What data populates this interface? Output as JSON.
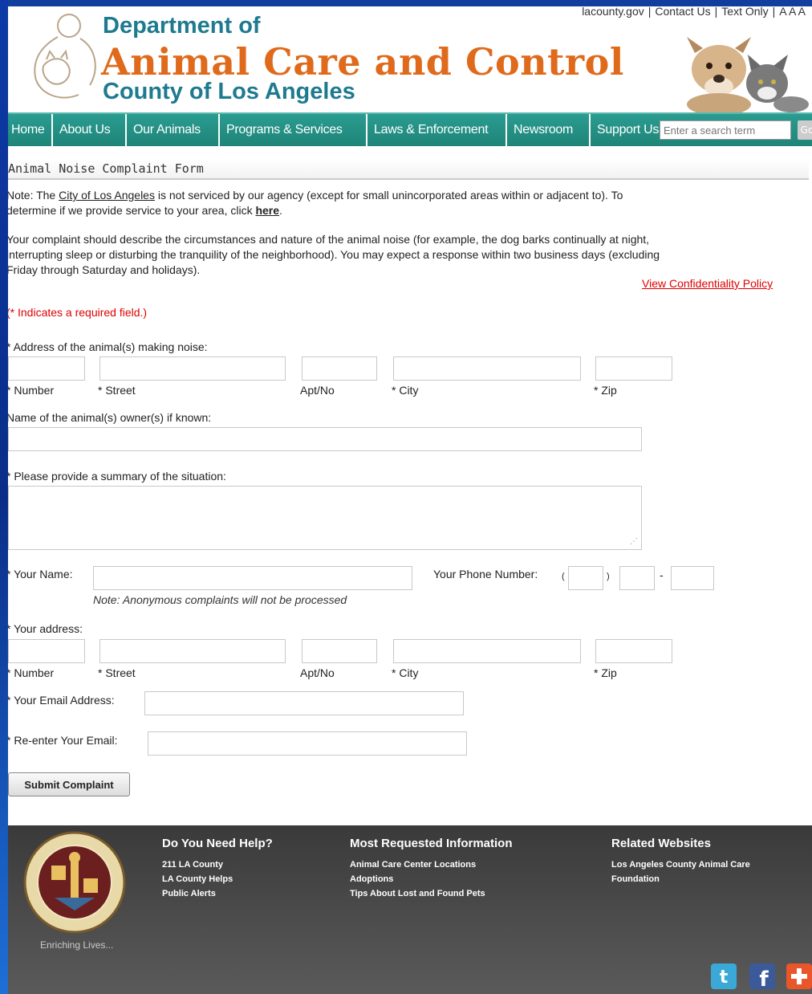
{
  "header": {
    "util_links": [
      "lacounty.gov",
      "Contact Us",
      "Text Only",
      "A A A"
    ],
    "title_line1": "Department of",
    "title_line2": "Animal Care and Control",
    "title_line3": "County of Los Angeles"
  },
  "nav": {
    "items": [
      "Home",
      "About Us",
      "Our Animals",
      "Programs & Services",
      "Laws & Enforcement",
      "Newsroom",
      "Support Us"
    ],
    "search_placeholder": "Enter a search term",
    "search_button": "Go"
  },
  "form": {
    "title": "Animal Noise Complaint Form",
    "note_prefix": "Note: The",
    "note_link": "City of Los Angeles",
    "note_mid": "is not serviced by our agency (except for small unincorporated areas within or adjacent to). To",
    "note_line2_prefix": "determine if we provide service to your area, click",
    "note_line2_link": "here",
    "note_line2_suffix": ".",
    "description_line1": "Your complaint should describe the circumstances and nature of the animal noise (for example, the dog barks continually at night,",
    "description_line2": "interrupting sleep or disturbing the tranquility of the neighborhood). You may expect a response within two business days (excluding",
    "description_line3": "Friday through Saturday and holidays).",
    "confidentiality_link": "View Confidentiality Policy",
    "required_note": "(* Indicates a required field.)",
    "animal_address_label": "* Address of the animal(s) making noise:",
    "addr_labels": {
      "number": "* Number",
      "street": "* Street",
      "apt": "Apt/No",
      "city": "* City",
      "zip": "* Zip"
    },
    "owner_label": "Name of the animal(s) owner(s) if known:",
    "summary_label": "* Please provide a summary of the situation:",
    "your_name_label": "* Your Name:",
    "phone_label": "Your Phone Number:",
    "phone_paren_open": "(",
    "phone_paren_close": ")",
    "phone_dash": "-",
    "anon_note": "Note: Anonymous complaints will not be processed",
    "your_address_label": "* Your address:",
    "email_label": "* Your Email Address:",
    "reemail_label": "* Re-enter Your Email:",
    "submit": "Submit Complaint"
  },
  "footer": {
    "seal_caption": "Enriching Lives...",
    "help_heading": "Do You Need Help?",
    "help_links": [
      "211 LA County",
      "LA County Helps",
      "Public Alerts"
    ],
    "info_heading": "Most Requested Information",
    "info_links": [
      "Animal Care Center Locations",
      "Adoptions",
      "Tips About Lost and Found Pets"
    ],
    "related_heading": "Related Websites",
    "related_links": [
      "Los Angeles County Animal Care",
      "Foundation"
    ]
  },
  "colors": {
    "teal": "#1f8478",
    "orange": "#e06a1c",
    "title_teal": "#1e7a8f",
    "required_red": "#e00000"
  }
}
